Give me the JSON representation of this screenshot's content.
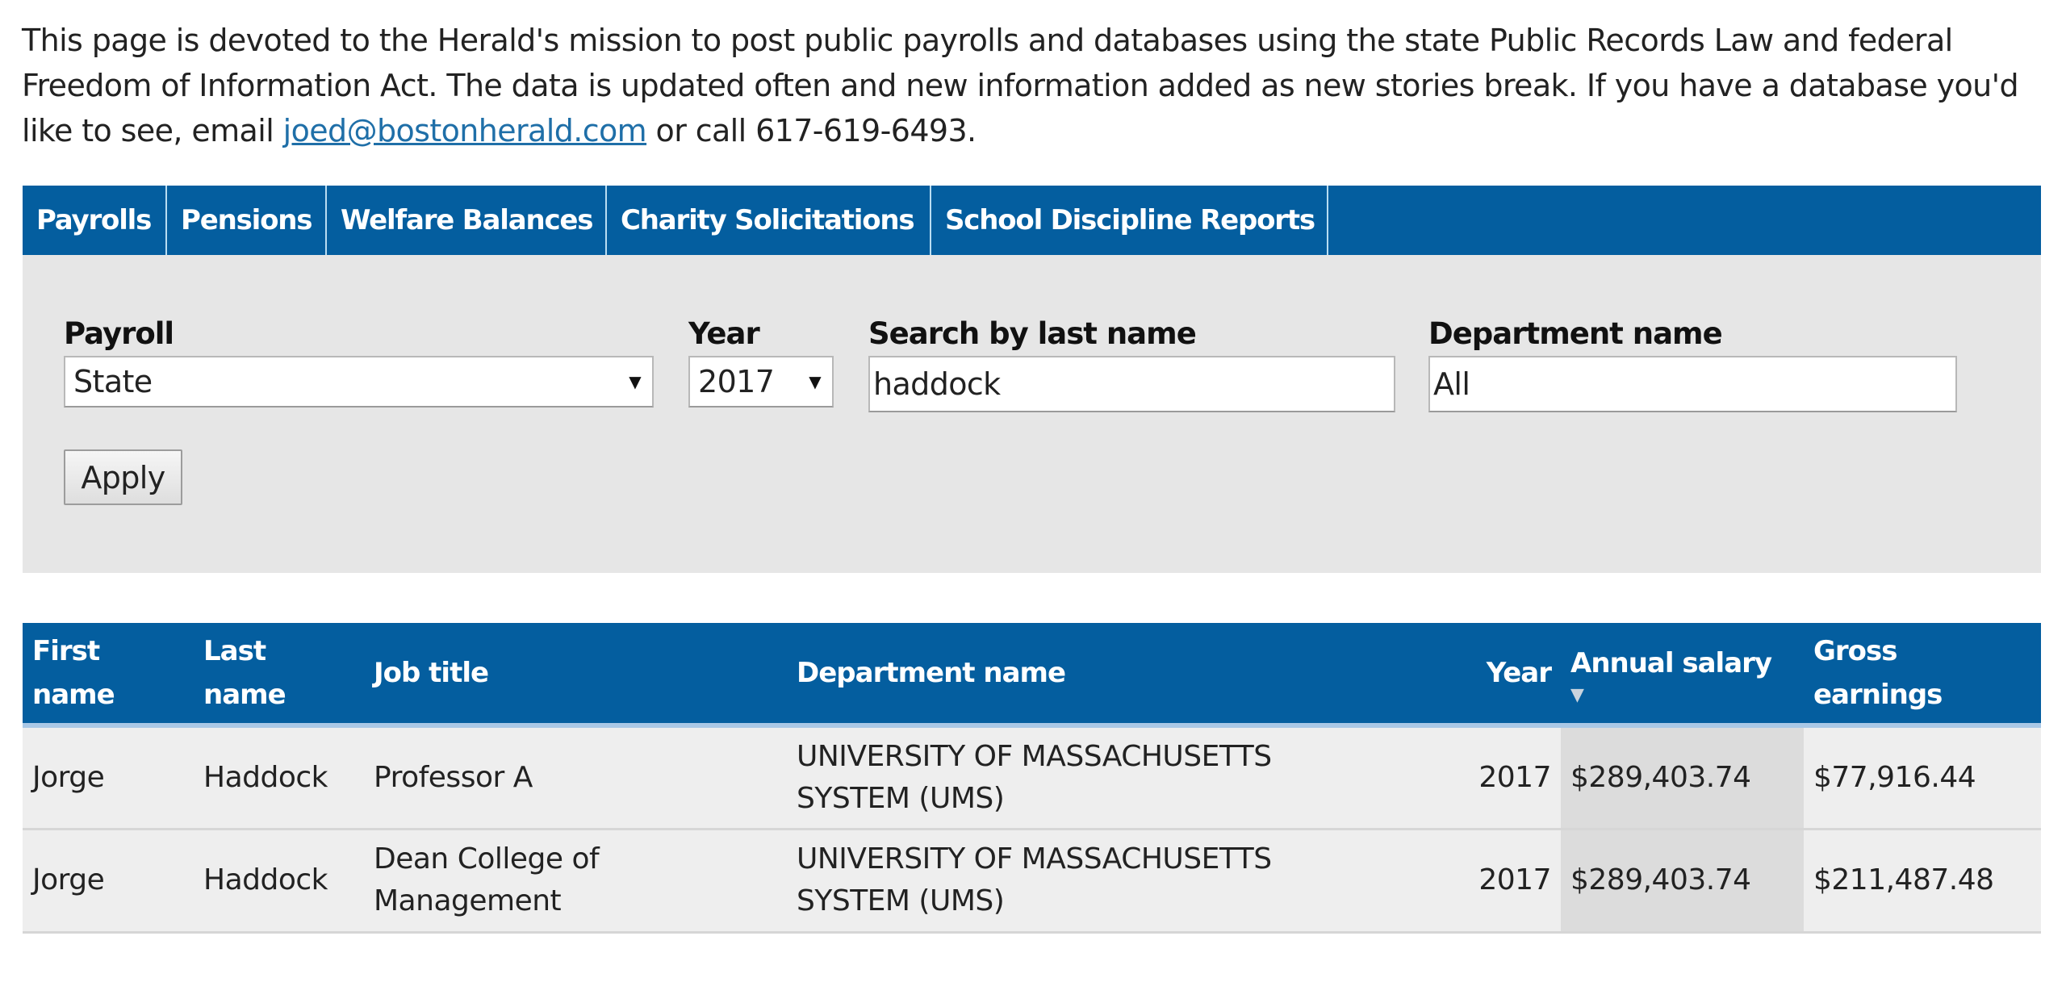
{
  "intro": {
    "text_before_email": "This page is devoted to the Herald's mission to post public payrolls and databases using the state Public Records Law and federal Freedom of Information Act. The data is updated often and new information added as new stories break. If you have a database you'd like to see, email ",
    "email": "joed@bostonherald.com",
    "text_after_email": " or call 617-619-6493."
  },
  "tabs": [
    {
      "label": "Payrolls"
    },
    {
      "label": "Pensions"
    },
    {
      "label": "Welfare Balances"
    },
    {
      "label": "Charity Solicitations"
    },
    {
      "label": "School Discipline Reports"
    }
  ],
  "filters": {
    "payroll": {
      "label": "Payroll",
      "value": "State"
    },
    "year": {
      "label": "Year",
      "value": "2017"
    },
    "last_name": {
      "label": "Search by last name",
      "value": "haddock"
    },
    "department": {
      "label": "Department name",
      "value": "All"
    },
    "apply_label": "Apply"
  },
  "table": {
    "columns": [
      {
        "label": "First name"
      },
      {
        "label": "Last name"
      },
      {
        "label": "Job title"
      },
      {
        "label": "Department name"
      },
      {
        "label": "Year"
      },
      {
        "label": "Annual salary",
        "sorted": "descending"
      },
      {
        "label": "Gross earnings"
      }
    ],
    "rows": [
      {
        "first_name": "Jorge",
        "last_name": "Haddock",
        "job_title": "Professor A",
        "department": "UNIVERSITY OF MASSACHUSETTS SYSTEM (UMS)",
        "year": "2017",
        "annual_salary": "$289,403.74",
        "gross_earnings": "$77,916.44"
      },
      {
        "first_name": "Jorge",
        "last_name": "Haddock",
        "job_title": "Dean College of Management",
        "department": "UNIVERSITY OF MASSACHUSETTS SYSTEM (UMS)",
        "year": "2017",
        "annual_salary": "$289,403.74",
        "gross_earnings": "$211,487.48"
      }
    ]
  },
  "colors": {
    "brand_blue": "#045e9f",
    "panel_gray": "#e6e6e6",
    "link": "#1f6fa8"
  }
}
